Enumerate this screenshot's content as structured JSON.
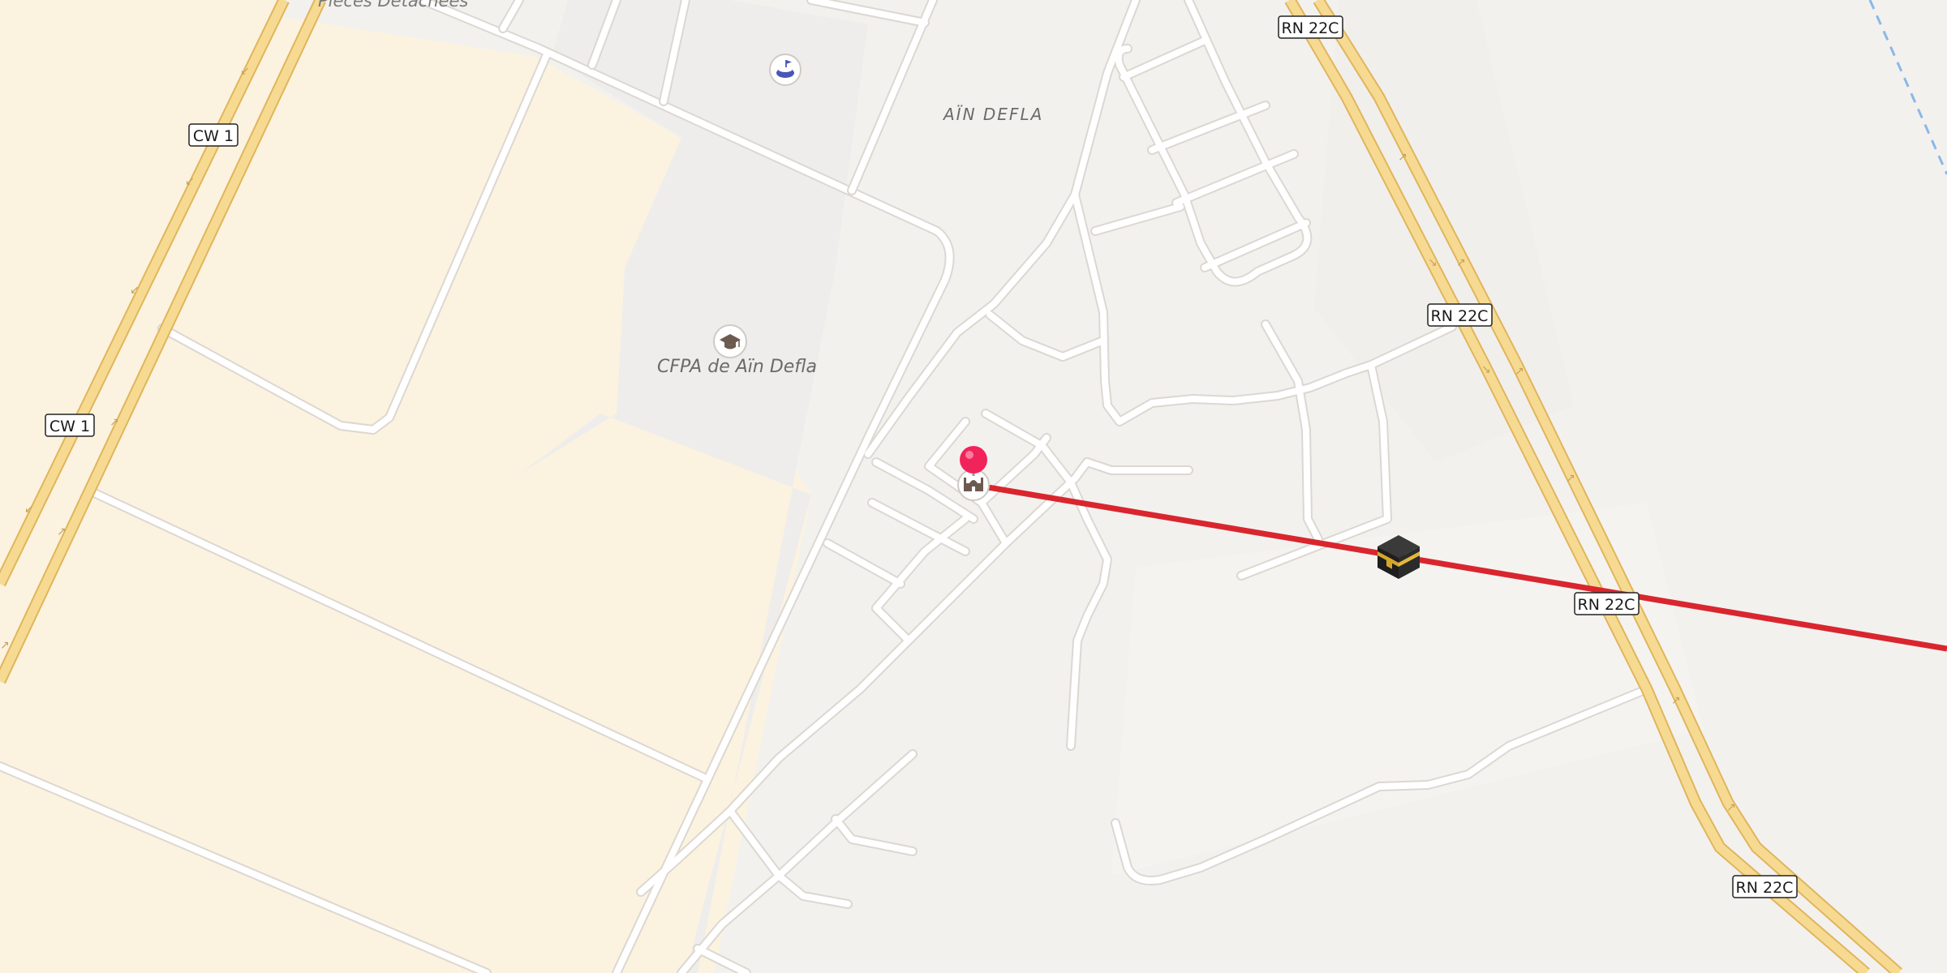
{
  "map": {
    "place_label": "AÏN DEFLA",
    "poi_school_label": "CFPA de Aïn Defla",
    "top_clipped_label": "Pièces Détachées",
    "road_labels": {
      "cw1_top": "CW 1",
      "cw1_left": "CW 1",
      "rn22c_top": "RN 22C",
      "rn22c_mid": "RN 22C",
      "rn22c_route": "RN 22C",
      "rn22c_bottom": "RN 22C"
    },
    "icons": {
      "pin": "map-pin-icon",
      "mosque": "mosque-icon",
      "kaaba": "kaaba-icon",
      "school": "graduation-cap-icon",
      "stadium": "stadium-icon"
    },
    "colors": {
      "qibla_line": "#d9262e",
      "pin": "#f0245a",
      "highway_fill": "#f7da92",
      "highway_casing": "#e0b55c",
      "farmland": "#fbf3df",
      "landuse": "#efedeb",
      "background": "#f3f1ee",
      "minor_road": "#ffffff",
      "water_dash": "#8ab8e8"
    }
  }
}
